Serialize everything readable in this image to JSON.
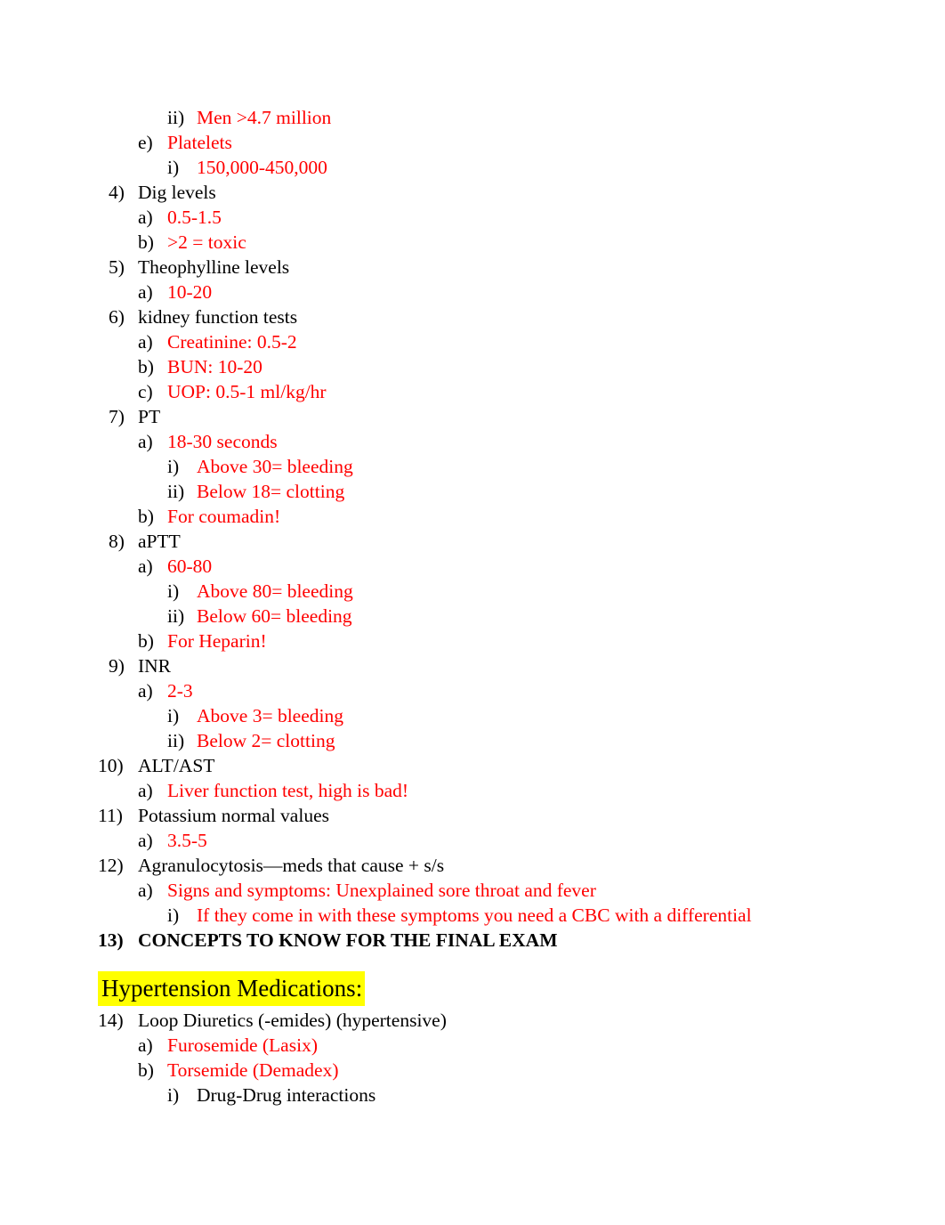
{
  "document": {
    "colors": {
      "body_text": "#000000",
      "accent_text": "#ff0000",
      "highlight": "#ffff00",
      "page_background": "#ffffff"
    },
    "outline": [
      {
        "level": 3,
        "marker": "ii)",
        "text": "Men >4.7 million",
        "color": "red",
        "bold": false
      },
      {
        "level": 2,
        "marker": "e)",
        "text": "Platelets",
        "color": "red",
        "bold": false
      },
      {
        "level": 3,
        "marker": "i)",
        "text": "150,000-450,000",
        "color": "red",
        "bold": false
      },
      {
        "level": 1,
        "marker": "4)",
        "text": "Dig levels",
        "color": "black",
        "bold": false
      },
      {
        "level": 2,
        "marker": "a)",
        "text": "0.5-1.5",
        "color": "red",
        "bold": false
      },
      {
        "level": 2,
        "marker": "b)",
        "text": ">2 = toxic",
        "color": "red",
        "bold": false
      },
      {
        "level": 1,
        "marker": "5)",
        "text": "Theophylline levels",
        "color": "black",
        "bold": false
      },
      {
        "level": 2,
        "marker": "a)",
        "text": "10-20",
        "color": "red",
        "bold": false
      },
      {
        "level": 1,
        "marker": "6)",
        "text": "kidney function tests",
        "color": "black",
        "bold": false
      },
      {
        "level": 2,
        "marker": "a)",
        "text": "Creatinine: 0.5-2",
        "color": "red",
        "bold": false
      },
      {
        "level": 2,
        "marker": "b)",
        "text": "BUN: 10-20",
        "color": "red",
        "bold": false
      },
      {
        "level": 2,
        "marker": "c)",
        "text": "UOP: 0.5-1 ml/kg/hr",
        "color": "red",
        "bold": false
      },
      {
        "level": 1,
        "marker": "7)",
        "text": "PT",
        "color": "black",
        "bold": false
      },
      {
        "level": 2,
        "marker": "a)",
        "text": "18-30 seconds",
        "color": "red",
        "bold": false
      },
      {
        "level": 3,
        "marker": "i)",
        "text": "Above 30= bleeding",
        "color": "red",
        "bold": false
      },
      {
        "level": 3,
        "marker": "ii)",
        "text": "Below 18= clotting",
        "color": "red",
        "bold": false
      },
      {
        "level": 2,
        "marker": "b)",
        "text": "For coumadin!",
        "color": "red",
        "bold": false
      },
      {
        "level": 1,
        "marker": "8)",
        "text": "aPTT",
        "color": "black",
        "bold": false
      },
      {
        "level": 2,
        "marker": "a)",
        "text": "60-80",
        "color": "red",
        "bold": false
      },
      {
        "level": 3,
        "marker": "i)",
        "text": "Above 80= bleeding",
        "color": "red",
        "bold": false
      },
      {
        "level": 3,
        "marker": "ii)",
        "text": "Below 60= bleeding",
        "color": "red",
        "bold": false
      },
      {
        "level": 2,
        "marker": "b)",
        "text": "For Heparin!",
        "color": "red",
        "bold": false
      },
      {
        "level": 1,
        "marker": "9)",
        "text": "INR",
        "color": "black",
        "bold": false
      },
      {
        "level": 2,
        "marker": "a)",
        "text": "2-3",
        "color": "red",
        "bold": false
      },
      {
        "level": 3,
        "marker": "i)",
        "text": "Above 3= bleeding",
        "color": "red",
        "bold": false
      },
      {
        "level": 3,
        "marker": "ii)",
        "text": "Below 2= clotting",
        "color": "red",
        "bold": false
      },
      {
        "level": 1,
        "marker": "10)",
        "text": "ALT/AST",
        "color": "black",
        "bold": false,
        "wide": true
      },
      {
        "level": 2,
        "marker": "a)",
        "text": "Liver function test, high is bad!",
        "color": "red",
        "bold": false
      },
      {
        "level": 1,
        "marker": "11)",
        "text": "Potassium normal values",
        "color": "black",
        "bold": false,
        "wide": true
      },
      {
        "level": 2,
        "marker": "a)",
        "text": "3.5-5",
        "color": "red",
        "bold": false
      },
      {
        "level": 1,
        "marker": "12)",
        "text": "Agranulocytosis—meds that cause + s/s",
        "color": "black",
        "bold": false,
        "wide": true
      },
      {
        "level": 2,
        "marker": "a)",
        "text": "Signs and symptoms: Unexplained sore throat and fever",
        "color": "red",
        "bold": false
      },
      {
        "level": 3,
        "marker": "i)",
        "text": "If they come in with these symptoms you need a CBC with a differential",
        "color": "red",
        "bold": false
      },
      {
        "level": 1,
        "marker": "13)",
        "text": "CONCEPTS TO KNOW FOR THE FINAL EXAM",
        "color": "black",
        "bold": true,
        "wide": true
      }
    ],
    "section_heading": "Hypertension Medications:",
    "outline_after_heading": [
      {
        "level": 1,
        "marker": "14)",
        "text": "Loop Diuretics (-emides) (hypertensive)",
        "color": "black",
        "bold": false,
        "wide": true
      },
      {
        "level": 2,
        "marker": "a)",
        "text": "Furosemide (Lasix)",
        "color": "red",
        "bold": false
      },
      {
        "level": 2,
        "marker": "b)",
        "text": "Torsemide (Demadex)",
        "color": "red",
        "bold": false
      },
      {
        "level": 3,
        "marker": "i)",
        "text": "Drug-Drug interactions",
        "color": "black",
        "bold": false
      }
    ]
  }
}
